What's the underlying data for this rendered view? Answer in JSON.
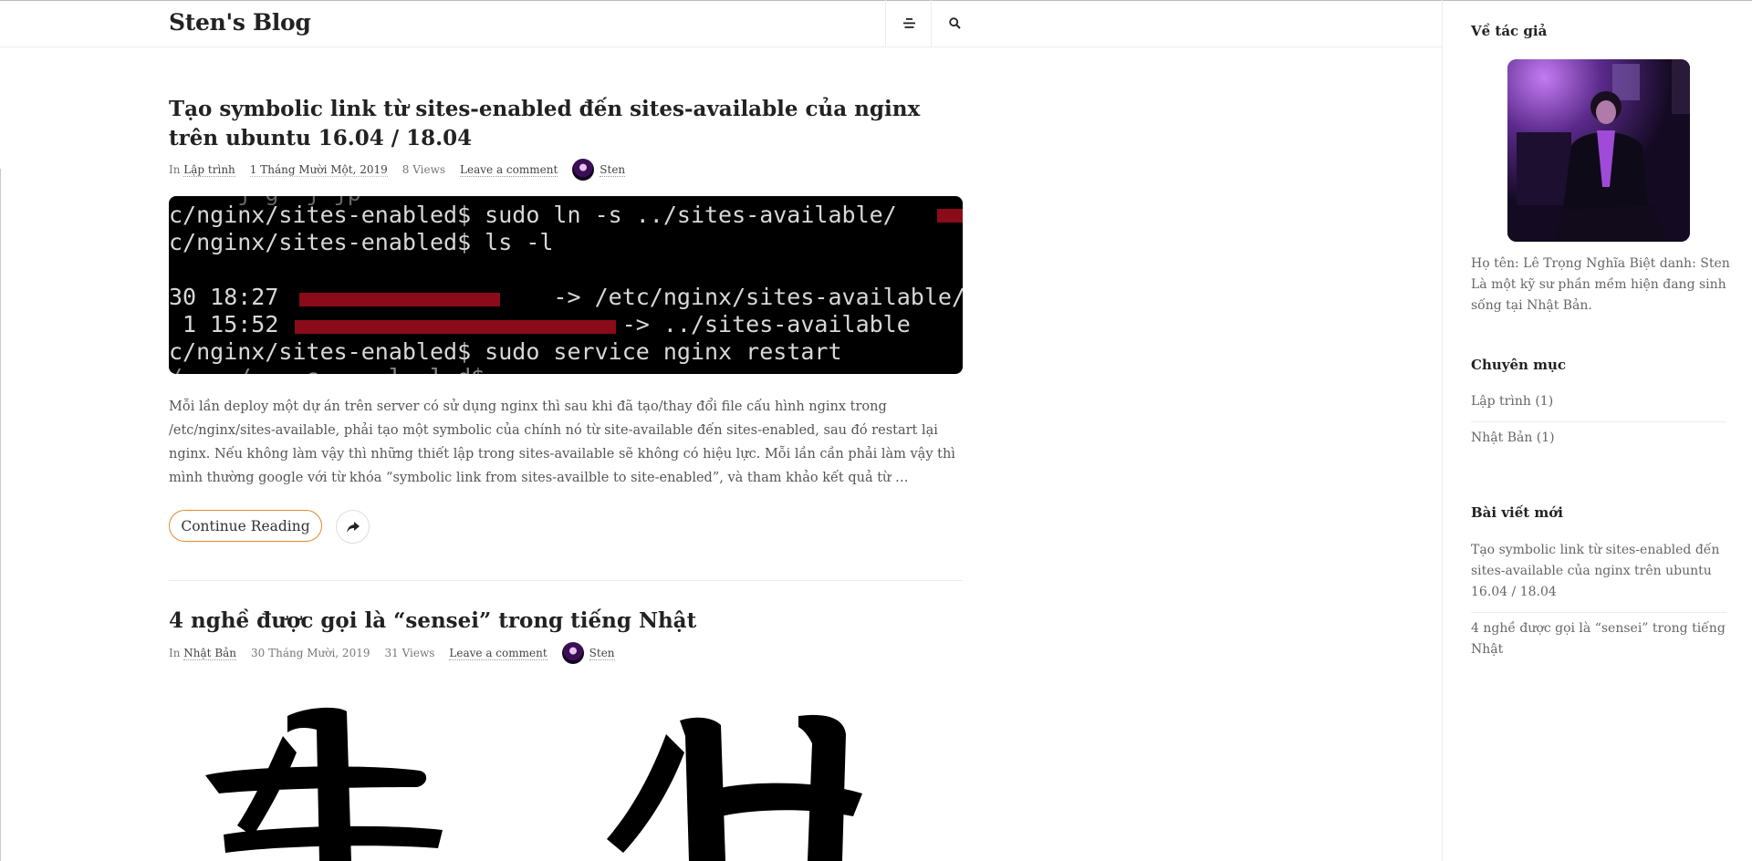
{
  "site": {
    "title": "Sten's Blog"
  },
  "posts": [
    {
      "title": "Tạo symbolic link từ sites-enabled đến sites-available của nginx trên ubuntu 16.04 / 18.04",
      "meta": {
        "in_label": "In",
        "category": "Lập trình",
        "date": "1 Tháng Mười Một, 2019",
        "views": "8 Views",
        "comment": "Leave a comment",
        "author": "Sten"
      },
      "terminal_lines": [
        "c/nginx/sites-enabled$ sudo ln -s ../sites-available/",
        "c/nginx/sites-enabled$ ls -l",
        "30 18:27                    -> /etc/nginx/sites-available/",
        " 1 15:52                         -> ../sites-available",
        "c/nginx/sites-enabled$ sudo service nginx restart"
      ],
      "excerpt": "Mỗi lần deploy một dự án trên server có sử dụng nginx thì sau khi đã tạo/thay đổi file cấu hình nginx trong /etc/nginx/sites-available, phải tạo một symbolic của chính nó từ site-available đến sites-enabled, sau đó restart lại nginx. Nếu không làm vậy thì những thiết lập trong sites-available sẽ không có hiệu lực. Mỗi lần cần phải làm vậy thì mình thường google với từ khóa “symbolic link from sites-availble to site-enabled”, và tham khảo kết quả từ …",
      "continue_label": "Continue Reading"
    },
    {
      "title": "4 nghề được gọi là “sensei” trong tiếng Nhật",
      "meta": {
        "in_label": "In",
        "category": "Nhật Bản",
        "date": "30 Tháng Mười, 2019",
        "views": "31 Views",
        "comment": "Leave a comment",
        "author": "Sten"
      }
    }
  ],
  "sidebar": {
    "about": {
      "title": "Về tác giả",
      "bio": "Họ tên: Lê Trọng Nghĩa Biệt danh: Sten Là một kỹ sư phần mềm hiện đang sinh sống tại Nhật Bản."
    },
    "categories": {
      "title": "Chuyên mục",
      "items": [
        "Lập trình (1)",
        "Nhật Bản (1)"
      ]
    },
    "recent": {
      "title": "Bài viết mới",
      "items": [
        "Tạo symbolic link từ sites-enabled đến sites-available của nginx trên ubuntu 16.04 / 18.04",
        "4 nghề được gọi là “sensei” trong tiếng Nhật"
      ]
    }
  },
  "icons": {
    "menu": "menu-icon",
    "search": "search-icon",
    "share": "share-icon"
  },
  "colors": {
    "accent": "#e08a2c",
    "redaction": "#8c0b1a"
  }
}
